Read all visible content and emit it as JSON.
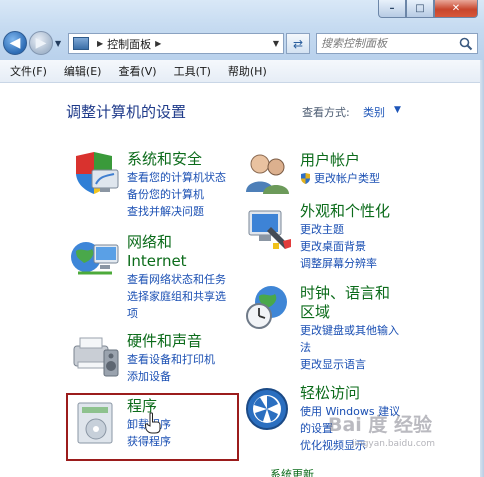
{
  "address_bar": {
    "location": "控制面板"
  },
  "search": {
    "placeholder": "搜索控制面板"
  },
  "menu": [
    "文件(F)",
    "编辑(E)",
    "查看(V)",
    "工具(T)",
    "帮助(H)"
  ],
  "page": {
    "title": "调整计算机的设置",
    "view_by_label": "查看方式:",
    "view_by_value": "类别"
  },
  "categories": {
    "system_security": {
      "title": "系统和安全",
      "links": [
        "查看您的计算机状态",
        "备份您的计算机",
        "查找并解决问题"
      ]
    },
    "network": {
      "title_line1": "网络和",
      "title_line2": "Internet",
      "links": [
        "查看网络状态和任务",
        "选择家庭组和共享选",
        "项"
      ]
    },
    "hardware_sound": {
      "title": "硬件和声音",
      "links": [
        "查看设备和打印机",
        "添加设备"
      ]
    },
    "programs": {
      "title": "程序",
      "links": [
        "卸载程序",
        "获得程序"
      ]
    },
    "user_accounts": {
      "title": "用户帐户",
      "links": [
        "更改帐户类型"
      ]
    },
    "appearance": {
      "title": "外观和个性化",
      "links": [
        "更改主题",
        "更改桌面背景",
        "调整屏幕分辨率"
      ]
    },
    "clock_region": {
      "title_line1": "时钟、语言和",
      "title_line2": "区域",
      "links": [
        "更改键盘或其他输入",
        "法",
        "更改显示语言"
      ]
    },
    "ease_access": {
      "title": "轻松访问",
      "links": [
        "使用 Windows 建议",
        "的设置",
        "优化视频显示"
      ]
    }
  },
  "bottom_partial": "系统更新",
  "watermark": {
    "text": "Bai 度 经验",
    "url": "jingyan.baidu.com"
  },
  "colors": {
    "title_bar": "#c6dbf1",
    "category_title": "#0b6b1a",
    "link": "#1a4fb3",
    "highlight_border": "#9b1c1c"
  }
}
